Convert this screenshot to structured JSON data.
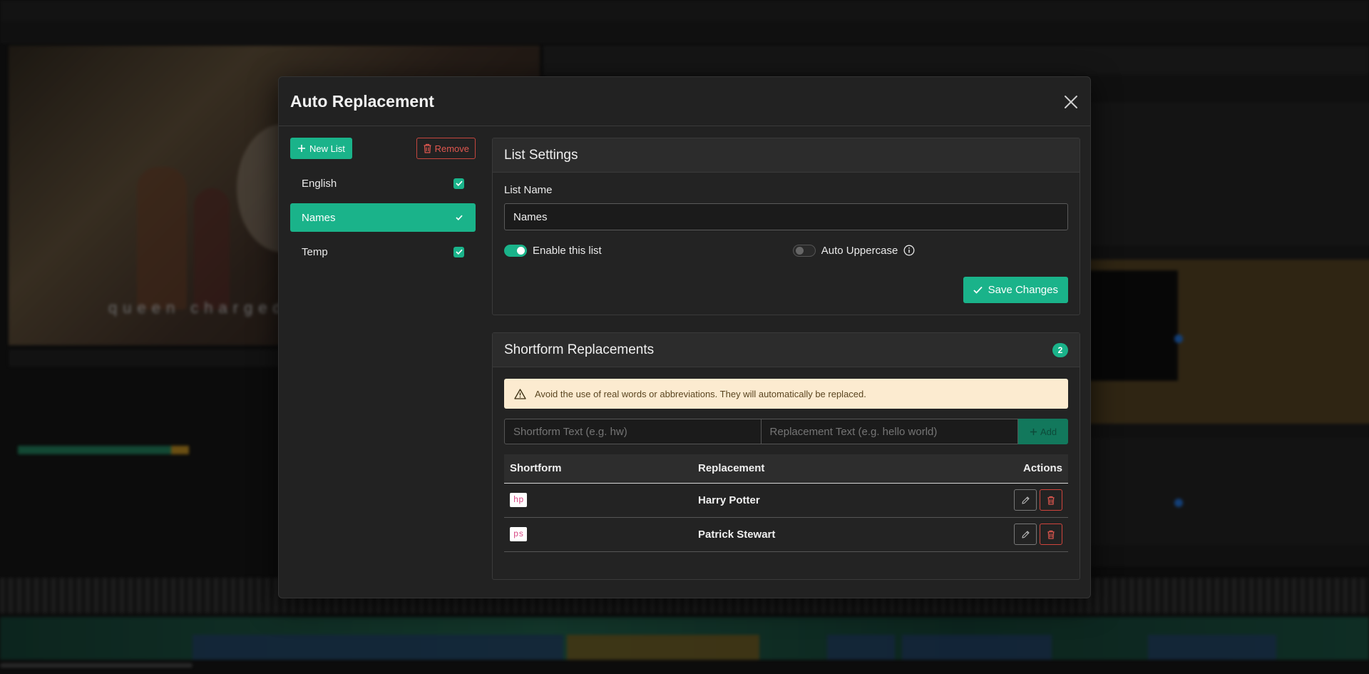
{
  "modal": {
    "title": "Auto Replacement"
  },
  "sidebar": {
    "new_list_label": "New List",
    "remove_label": "Remove",
    "lists": [
      {
        "label": "English",
        "checked": true,
        "active": false
      },
      {
        "label": "Names",
        "checked": true,
        "active": true
      },
      {
        "label": "Temp",
        "checked": true,
        "active": false
      }
    ]
  },
  "settings": {
    "title": "List Settings",
    "list_name_label": "List Name",
    "list_name_value": "Names",
    "enable_label": "Enable this list",
    "enable_on": true,
    "uppercase_label": "Auto Uppercase",
    "uppercase_on": false,
    "save_label": "Save Changes"
  },
  "shortform": {
    "title": "Shortform Replacements",
    "count": "2",
    "alert": "Avoid the use of real words or abbreviations. They will automatically be replaced.",
    "shortform_placeholder": "Shortform Text (e.g. hw)",
    "replacement_placeholder": "Replacement Text (e.g. hello world)",
    "add_label": "Add",
    "columns": {
      "shortform": "Shortform",
      "replacement": "Replacement",
      "actions": "Actions"
    },
    "rows": [
      {
        "shortform": "hp",
        "replacement": "Harry Potter"
      },
      {
        "shortform": "ps",
        "replacement": "Patrick Stewart"
      }
    ]
  },
  "background": {
    "subtitle_text": "queen charged"
  },
  "colors": {
    "accent": "#1ab38a",
    "danger": "#d0443c",
    "alert_bg": "#fcebd0",
    "modal_bg": "#222222"
  }
}
